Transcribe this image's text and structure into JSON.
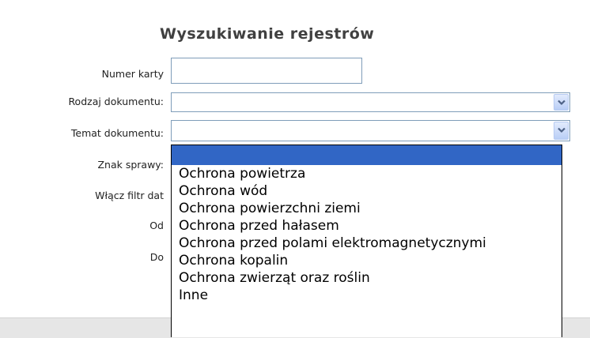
{
  "title": "Wyszukiwanie rejestrów",
  "form": {
    "numer_karty": {
      "label": "Numer karty",
      "value": ""
    },
    "rodzaj_dokumentu": {
      "label": "Rodzaj dokumentu:",
      "value": ""
    },
    "temat_dokumentu": {
      "label": "Temat dokumentu:",
      "value": ""
    },
    "znak_sprawy": {
      "label": "Znak sprawy:"
    },
    "filtr_dat": {
      "label": "Włącz filtr dat"
    },
    "od": {
      "label": "Od"
    },
    "do": {
      "label": "Do"
    }
  },
  "dropdown": {
    "open_for": "temat_dokumentu",
    "selected_index": 0,
    "options": [
      "",
      "Ochrona powietrza",
      "Ochrona wód",
      "Ochrona powierzchni ziemi",
      "Ochrona przed hałasem",
      "Ochrona przed polami elektromagnetycznymi",
      "Ochrona kopalin",
      "Ochrona zwierząt oraz roślin",
      "Inne"
    ]
  },
  "colors": {
    "highlight": "#3166c5",
    "field_border": "#7f9db9",
    "title_color": "#404040"
  },
  "icons": [
    "chevron-down-icon"
  ]
}
